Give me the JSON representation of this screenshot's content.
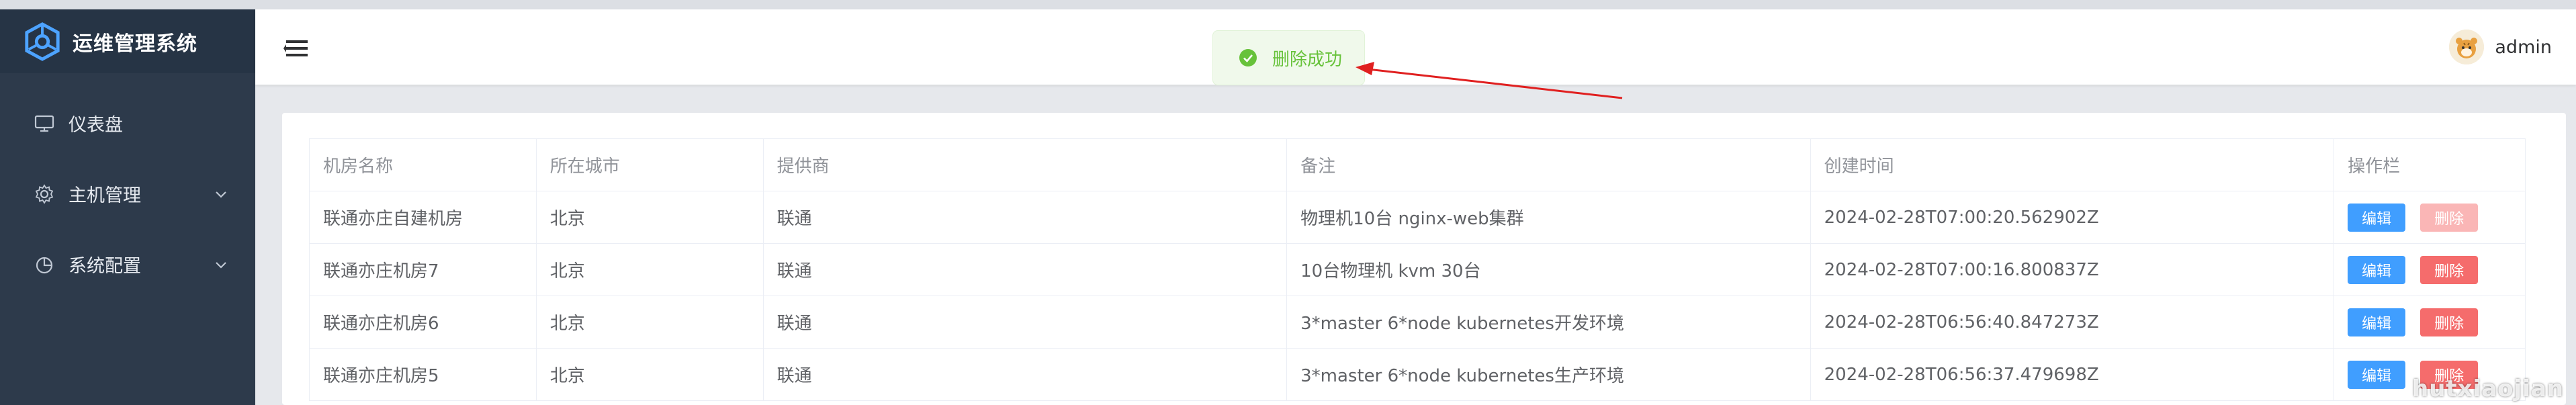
{
  "sidebar": {
    "brand_title": "运维管理系统",
    "items": [
      {
        "label": "仪表盘",
        "icon": "monitor-icon"
      },
      {
        "label": "主机管理",
        "icon": "gear-icon",
        "has_submenu": true
      },
      {
        "label": "系统配置",
        "icon": "pie-chart-icon",
        "has_submenu": true
      }
    ]
  },
  "header": {
    "username": "admin"
  },
  "toast": {
    "text": "删除成功",
    "type": "success"
  },
  "table": {
    "columns": [
      "机房名称",
      "所在城市",
      "提供商",
      "备注",
      "创建时间",
      "操作栏"
    ],
    "rows": [
      {
        "name": "联通亦庄自建机房",
        "city": "北京",
        "provider": "联通",
        "note": "物理机10台 nginx-web集群",
        "created": "2024-02-28T07:00:20.562902Z"
      },
      {
        "name": "联通亦庄机房7",
        "city": "北京",
        "provider": "联通",
        "note": "10台物理机 kvm 30台",
        "created": "2024-02-28T07:00:16.800837Z"
      },
      {
        "name": "联通亦庄机房6",
        "city": "北京",
        "provider": "联通",
        "note": "3*master 6*node kubernetes开发环境",
        "created": "2024-02-28T06:56:40.847273Z"
      },
      {
        "name": "联通亦庄机房5",
        "city": "北京",
        "provider": "联通",
        "note": "3*master 6*node kubernetes生产环境",
        "created": "2024-02-28T06:56:37.479698Z"
      }
    ],
    "edit_label": "编辑",
    "delete_label": "删除"
  },
  "watermark": "hutxiaojian",
  "colors": {
    "sidebar_bg": "#2d3a4b",
    "brand_bg": "#263445",
    "primary": "#409eff",
    "danger": "#f56c6c",
    "success": "#67c23a"
  }
}
